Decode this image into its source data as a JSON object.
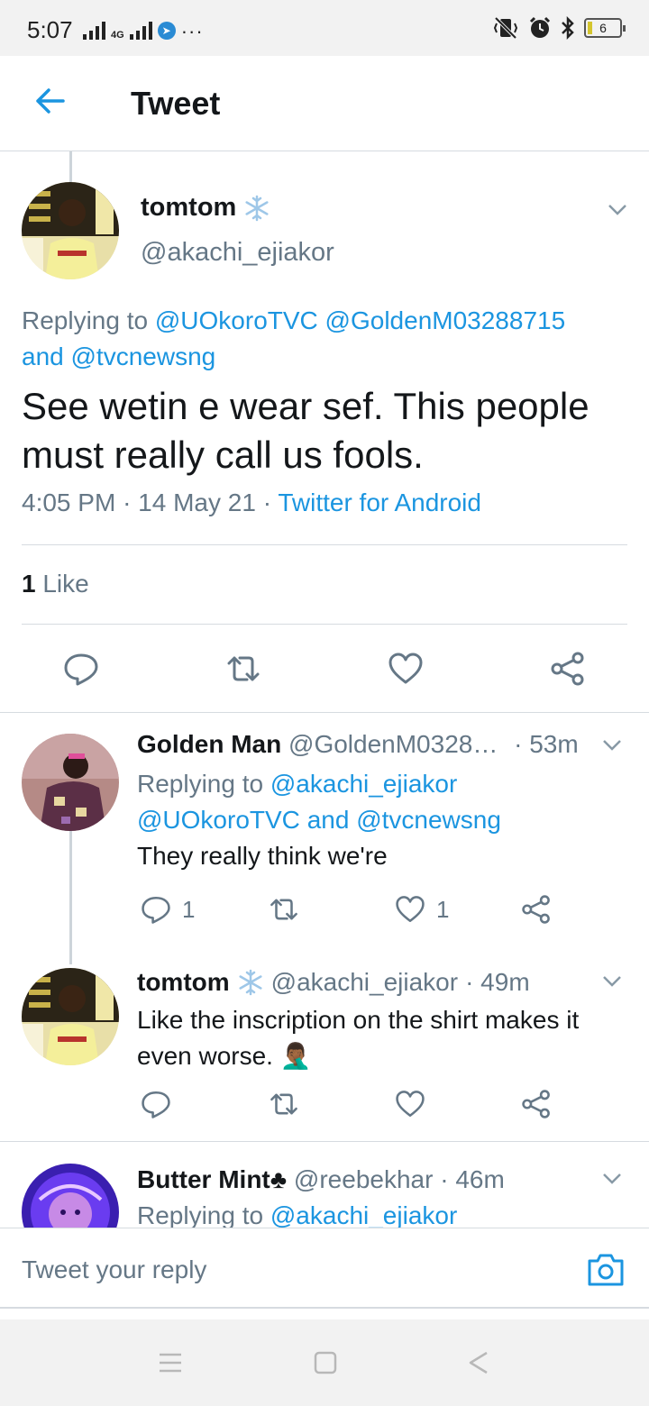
{
  "status_bar": {
    "time": "5:07",
    "network": "4G",
    "battery": "6"
  },
  "header": {
    "title": "Tweet"
  },
  "main_tweet": {
    "name": "tomtom",
    "handle": "@akachi_ejiakor",
    "replying_prefix": "Replying to",
    "replying_to_line1": "@UOkoroTVC @GoldenM03288715",
    "replying_and": "and",
    "replying_to_line2": "@tvcnewsng",
    "text_line1": "See wetin e wear sef. This people",
    "text_line2": "must really call us fools.",
    "time": "4:05 PM",
    "date": "14 May 21",
    "source": "Twitter for Android",
    "likes_count": "1",
    "likes_label": "Like"
  },
  "replies": [
    {
      "name": "Golden Man",
      "handle": "@GoldenM0328…",
      "age": "· 53m",
      "replying_prefix": "Replying to",
      "replying_to_line1": "@akachi_ejiakor",
      "replying_to_line2a": "@UOkoroTVC",
      "replying_and": "and",
      "replying_to_line2b": "@tvcnewsng",
      "text": "They really think we're",
      "reply_count": "1",
      "like_count": "1"
    },
    {
      "name": "tomtom",
      "handle": "@akachi_ejiakor",
      "age": "· 49m",
      "text_line1": "Like the inscription on the shirt makes it",
      "text_line2": "even worse.",
      "emoji": "🤦🏾‍♂️"
    },
    {
      "name": "Butter Mint",
      "name_suffix": "♣",
      "handle": "@reebekhar",
      "age": "· 46m",
      "replying_prefix": "Replying to",
      "replying_to_line1": "@akachi_ejiakor"
    }
  ],
  "reply_bar": {
    "placeholder": "Tweet your reply"
  },
  "colors": {
    "accent": "#1b95e0",
    "text": "#14171a",
    "secondary": "#657786",
    "divider": "#d6dbe0"
  },
  "icons": [
    "back-arrow-icon",
    "chevron-down-icon",
    "reply-icon",
    "retweet-icon",
    "like-icon",
    "share-icon",
    "camera-icon",
    "snowflake-icon"
  ]
}
